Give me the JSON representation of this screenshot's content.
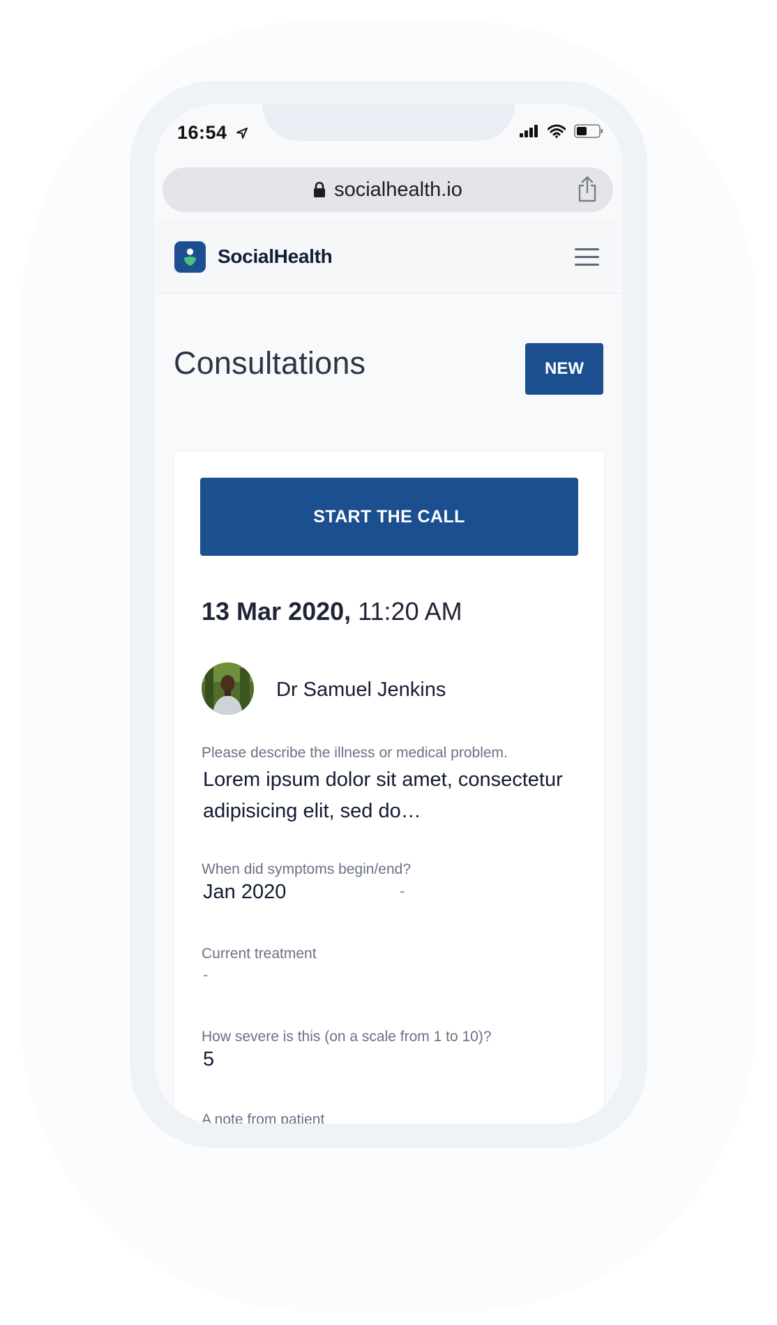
{
  "status_bar": {
    "time": "16:54"
  },
  "browser": {
    "url": "socialhealth.io"
  },
  "navbar": {
    "brand": "SocialHealth"
  },
  "page": {
    "title": "Consultations",
    "new_label": "NEW"
  },
  "consultation": {
    "start_call_label": "START THE CALL",
    "date": "13 Mar 2020,",
    "time": "11:20 AM",
    "doctor_name": "Dr Samuel Jenkins",
    "fields": {
      "illness_label": "Please describe the illness or medical problem.",
      "illness_value": "Lorem ipsum dolor sit amet, consectetur adipisicing elit, sed do…",
      "symptoms_label": "When did symptoms begin/end?",
      "symptoms_begin": "Jan 2020",
      "symptoms_end": "-",
      "treatment_label": "Current treatment",
      "treatment_value": "-",
      "severity_label": "How severe is this (on a scale from 1 to 10)?",
      "severity_value": "5",
      "note_label": "A note from patient"
    }
  },
  "colors": {
    "primary": "#1b4f8f",
    "brand_dark": "#121c38",
    "label": "#6a7186"
  }
}
